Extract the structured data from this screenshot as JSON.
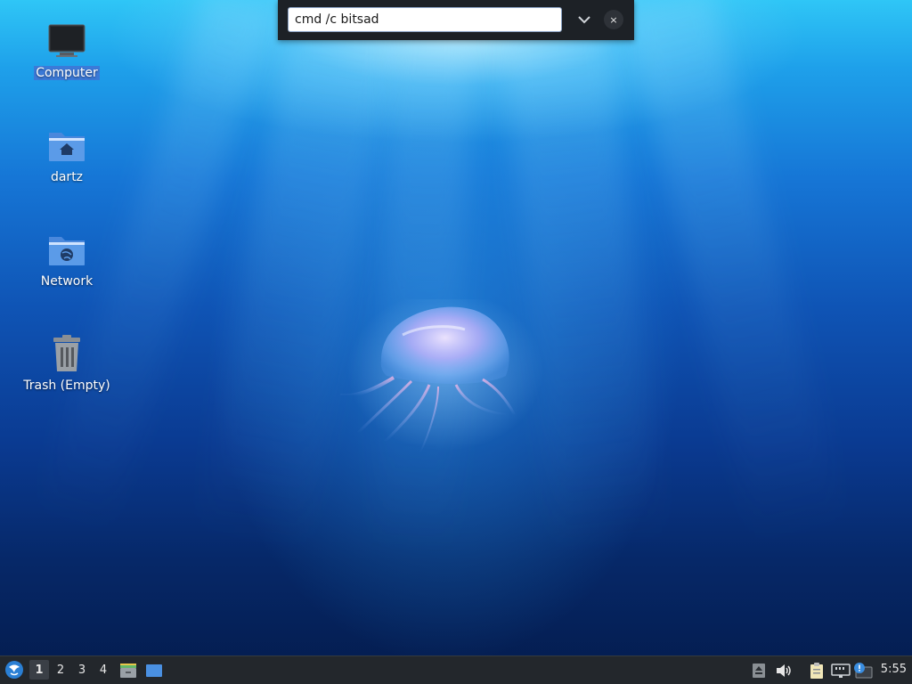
{
  "desktop": {
    "icons": [
      {
        "label": "Computer",
        "icon": "computer-icon",
        "selected": true
      },
      {
        "label": "dartz",
        "icon": "home-folder-icon",
        "selected": false
      },
      {
        "label": "Network",
        "icon": "network-folder-icon",
        "selected": false
      },
      {
        "label": "Trash (Empty)",
        "icon": "trash-icon",
        "selected": false
      }
    ]
  },
  "run_dialog": {
    "value": "cmd /c bitsad",
    "dropdown_icon": "chevron-down-icon",
    "close_label": "×"
  },
  "taskbar": {
    "start_icon": "lxqt-start-icon",
    "workspaces": [
      "1",
      "2",
      "3",
      "4"
    ],
    "active_workspace": "1",
    "launchers": [
      "file-manager-icon",
      "show-desktop-icon"
    ],
    "tray": [
      "eject-icon",
      "volume-icon",
      "clipboard-icon",
      "network-icon",
      "update-notifier-icon"
    ],
    "clock": "5:55"
  },
  "colors": {
    "taskbar_bg": "#23272c",
    "selection": "#466ed2",
    "folder_blue": "#5b9be8"
  }
}
